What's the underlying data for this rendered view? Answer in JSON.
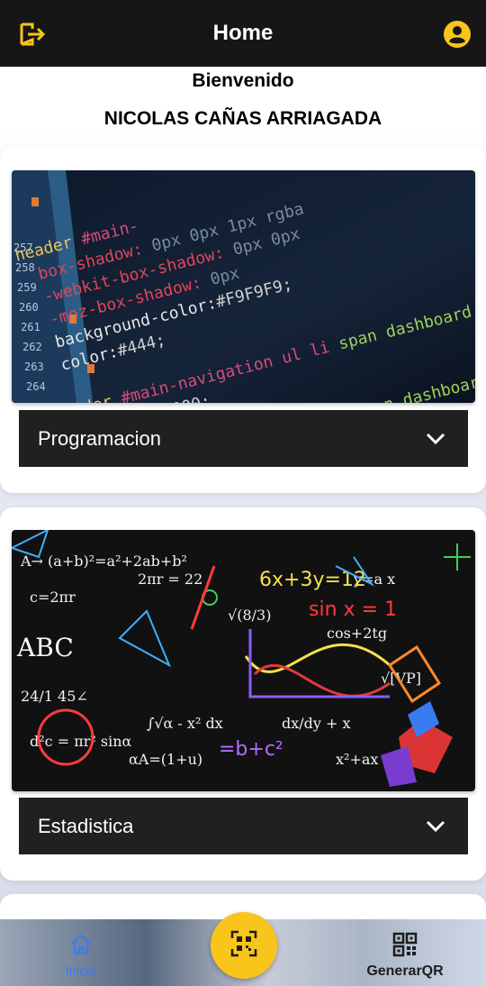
{
  "header": {
    "title": "Home",
    "logout_icon": "logout-icon",
    "profile_icon": "account-circle-icon",
    "accent_color": "#f9c51a"
  },
  "welcome": {
    "greeting": "Bienvenido",
    "user_name": "NICOLAS CAÑAS ARRIAGADA"
  },
  "subjects": [
    {
      "label": "Programacion",
      "image": "code-editor-css-photo",
      "icon": "chevron-down-icon"
    },
    {
      "label": "Estadistica",
      "image": "math-formulas-chalkboard",
      "icon": "chevron-down-icon"
    }
  ],
  "bottom_nav": {
    "home_label": "Inicio",
    "home_icon": "home-icon",
    "home_color": "#3a7bf2",
    "scan_icon": "qr-scan-icon",
    "generate_label": "GenerarQR",
    "generate_icon": "qr-code-icon"
  }
}
